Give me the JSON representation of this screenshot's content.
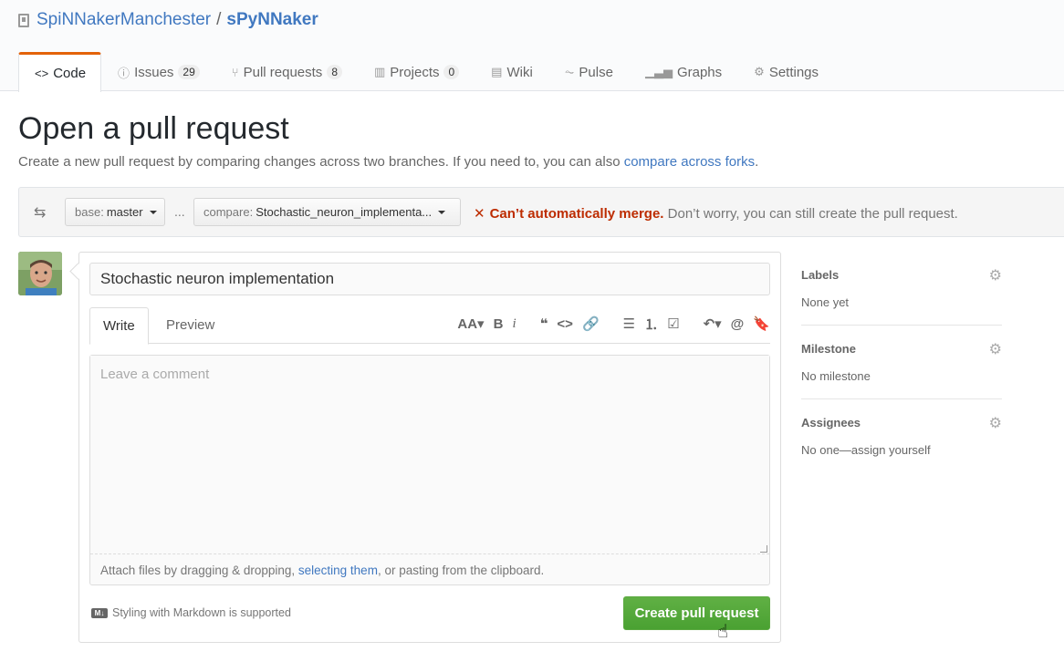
{
  "repo": {
    "owner": "SpiNNakerManchester",
    "separator": "/",
    "name": "sPyNNaker"
  },
  "tabs": [
    {
      "icon": "<>",
      "label": "Code",
      "count": ""
    },
    {
      "icon": "ⓘ",
      "label": "Issues",
      "count": "29"
    },
    {
      "icon": "⑂",
      "label": "Pull requests",
      "count": "8"
    },
    {
      "icon": "▥",
      "label": "Projects",
      "count": "0"
    },
    {
      "icon": "▤",
      "label": "Wiki",
      "count": ""
    },
    {
      "icon": "⏦",
      "label": "Pulse",
      "count": ""
    },
    {
      "icon": "▁▃▅",
      "label": "Graphs",
      "count": ""
    },
    {
      "icon": "⚙",
      "label": "Settings",
      "count": ""
    }
  ],
  "page": {
    "title": "Open a pull request",
    "desc_prefix": "Create a new pull request by comparing changes across two branches. If you need to, you can also ",
    "desc_link": "compare across forks",
    "desc_suffix": "."
  },
  "compare": {
    "base_label": "base:",
    "base_value": "master",
    "ellipsis": "...",
    "compare_label": "compare:",
    "compare_value": "Stochastic_neuron_implementa...",
    "status_mark": "✕",
    "status_bad": "Can’t automatically merge.",
    "status_rest": " Don’t worry, you can still create the pull request."
  },
  "form": {
    "title_value": "Stochastic neuron implementation",
    "tab_write": "Write",
    "tab_preview": "Preview",
    "comment_placeholder": "Leave a comment",
    "attach_prefix": "Attach files by dragging & dropping, ",
    "attach_link": "selecting them",
    "attach_suffix": ", or pasting from the clipboard.",
    "markdown_note": "Styling with Markdown is supported",
    "markdown_icon": "M↓",
    "submit_label": "Create pull request"
  },
  "toolbar": [
    "AA▾",
    "B",
    "i",
    "❝",
    "<>",
    "🔗",
    "☰",
    "⒈",
    "☑",
    "↶▾",
    "@",
    "🔖"
  ],
  "sidebar": [
    {
      "heading": "Labels",
      "value": "None yet"
    },
    {
      "heading": "Milestone",
      "value": "No milestone"
    },
    {
      "heading": "Assignees",
      "value": "No one—assign yourself"
    }
  ],
  "colors": {
    "link": "#4078c0",
    "accent_tab": "#e36209",
    "merge_error": "#bd2c00",
    "primary_button": "#5ca941"
  }
}
